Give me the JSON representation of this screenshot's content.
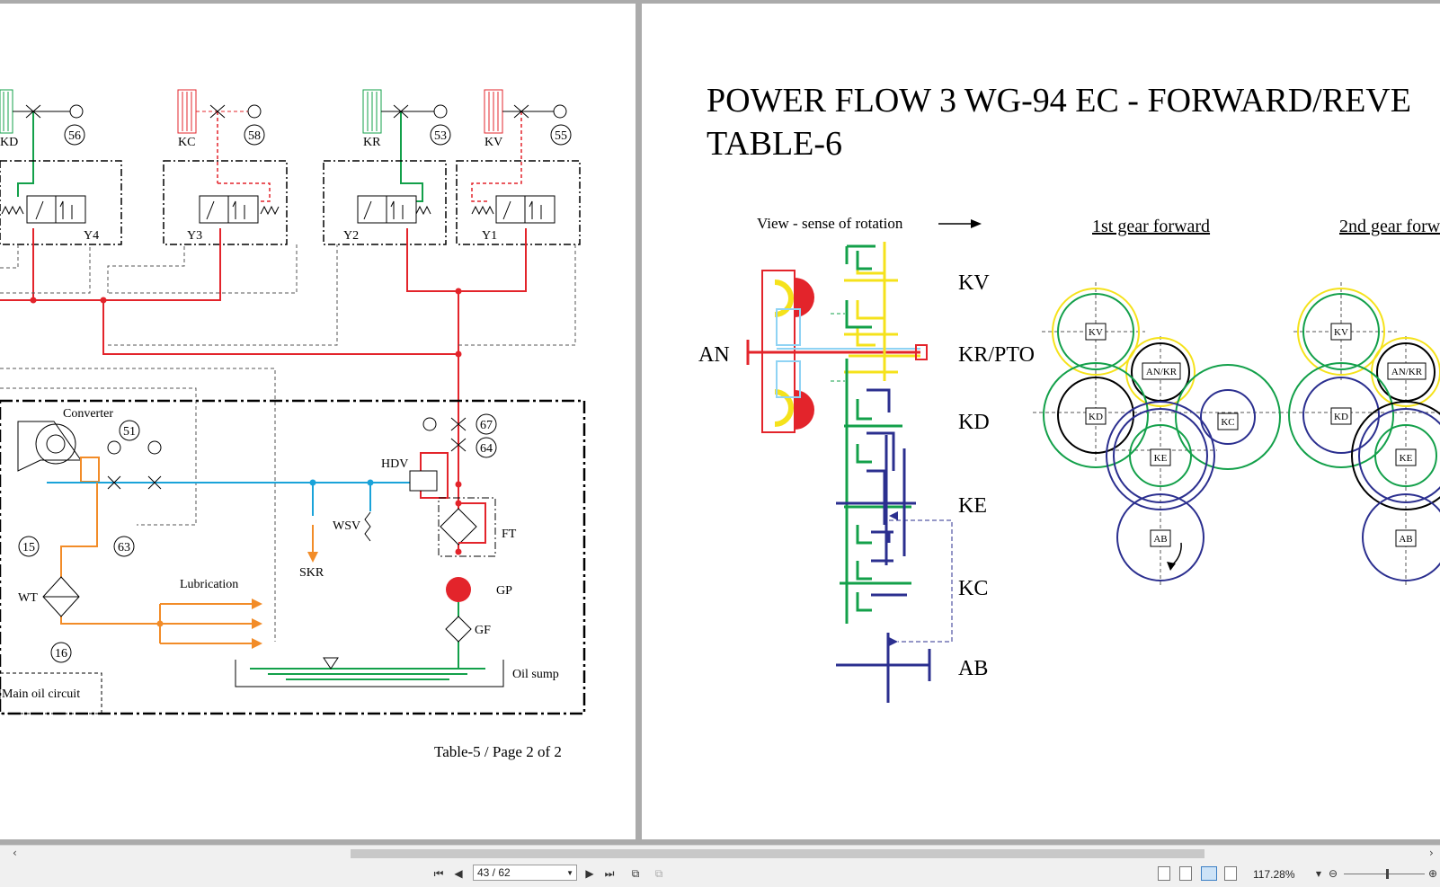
{
  "left_page": {
    "components": {
      "kd": "KD",
      "kc": "KC",
      "kr": "KR",
      "kv": "KV",
      "y4": "Y4",
      "y3": "Y3",
      "y2": "Y2",
      "y1": "Y1",
      "converter": "Converter",
      "hdv": "HDV",
      "wsv": "WSV",
      "skr": "SKR",
      "ft": "FT",
      "gp": "GP",
      "gf": "GF",
      "wt": "WT",
      "lubrication": "Lubrication",
      "oil_sump": "Oil sump",
      "main_oil_circuit": "Main oil circuit"
    },
    "gauges": [
      "56",
      "58",
      "53",
      "55",
      "51",
      "67",
      "64",
      "63",
      "15",
      "16"
    ],
    "footer": "Table-5 / Page 2 of 2"
  },
  "right_page": {
    "title_line1": "POWER FLOW 3 WG-94 EC - FORWARD/REVE",
    "title_line2": "TABLE-6",
    "view_label": "View - sense of rotation",
    "gear_labels": [
      "KV",
      "KR/PTO",
      "KD",
      "KE",
      "KC",
      "AB"
    ],
    "an_label": "AN",
    "col1_header": "1st gear forward",
    "col2_header": "2nd gear forw",
    "gear_boxes": {
      "kv": "KV",
      "ankr": "AN/KR",
      "kd": "KD",
      "kc": "KC",
      "ke": "KE",
      "ab": "AB"
    }
  },
  "toolbar": {
    "page_field": "43 / 62",
    "zoom": "117.28%"
  },
  "colors": {
    "red": "#e3242b",
    "green": "#13a04a",
    "blue": "#1aa3d9",
    "orange": "#f28c28",
    "yellow": "#f5e21b",
    "navy": "#2b2f8f",
    "light_blue": "#8fd3f4"
  }
}
